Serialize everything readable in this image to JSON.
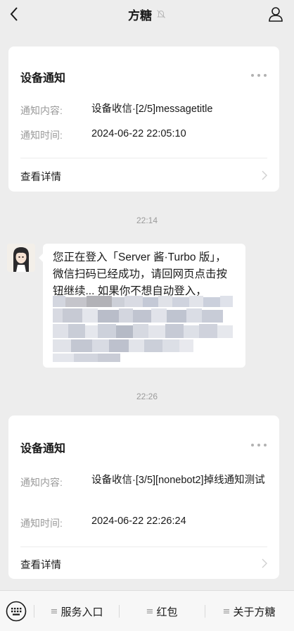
{
  "header": {
    "title": "方糖"
  },
  "cards": [
    {
      "title": "设备通知",
      "content_label": "通知内容:",
      "content_value": "设备收信·[2/5]messagetitle",
      "time_label": "通知时间:",
      "time_value": "2024-06-22 22:05:10",
      "link": "查看详情"
    },
    {
      "title": "设备通知",
      "content_label": "通知内容:",
      "content_value": "设备收信·[3/5][nonebot2]掉线通知测试",
      "time_label": "通知时间:",
      "time_value": "2024-06-22 22:26:24",
      "link": "查看详情"
    }
  ],
  "times": [
    "22:14",
    "22:26"
  ],
  "message": {
    "text": "您正在登入「Server 酱·Turbo 版」，微信扫码已经成功，请回网页点击按钮继续... 如果你不想自动登入，"
  },
  "bottom_menu": [
    {
      "label": "服务入口",
      "icon": "menu-lines-icon"
    },
    {
      "label": "红包",
      "icon": "menu-lines-icon"
    },
    {
      "label": "关于方糖",
      "icon": "menu-lines-icon"
    }
  ],
  "colors": {
    "background": "#ededed",
    "card": "#ffffff",
    "label_gray": "#9a9a9a",
    "divider": "#ececec"
  }
}
